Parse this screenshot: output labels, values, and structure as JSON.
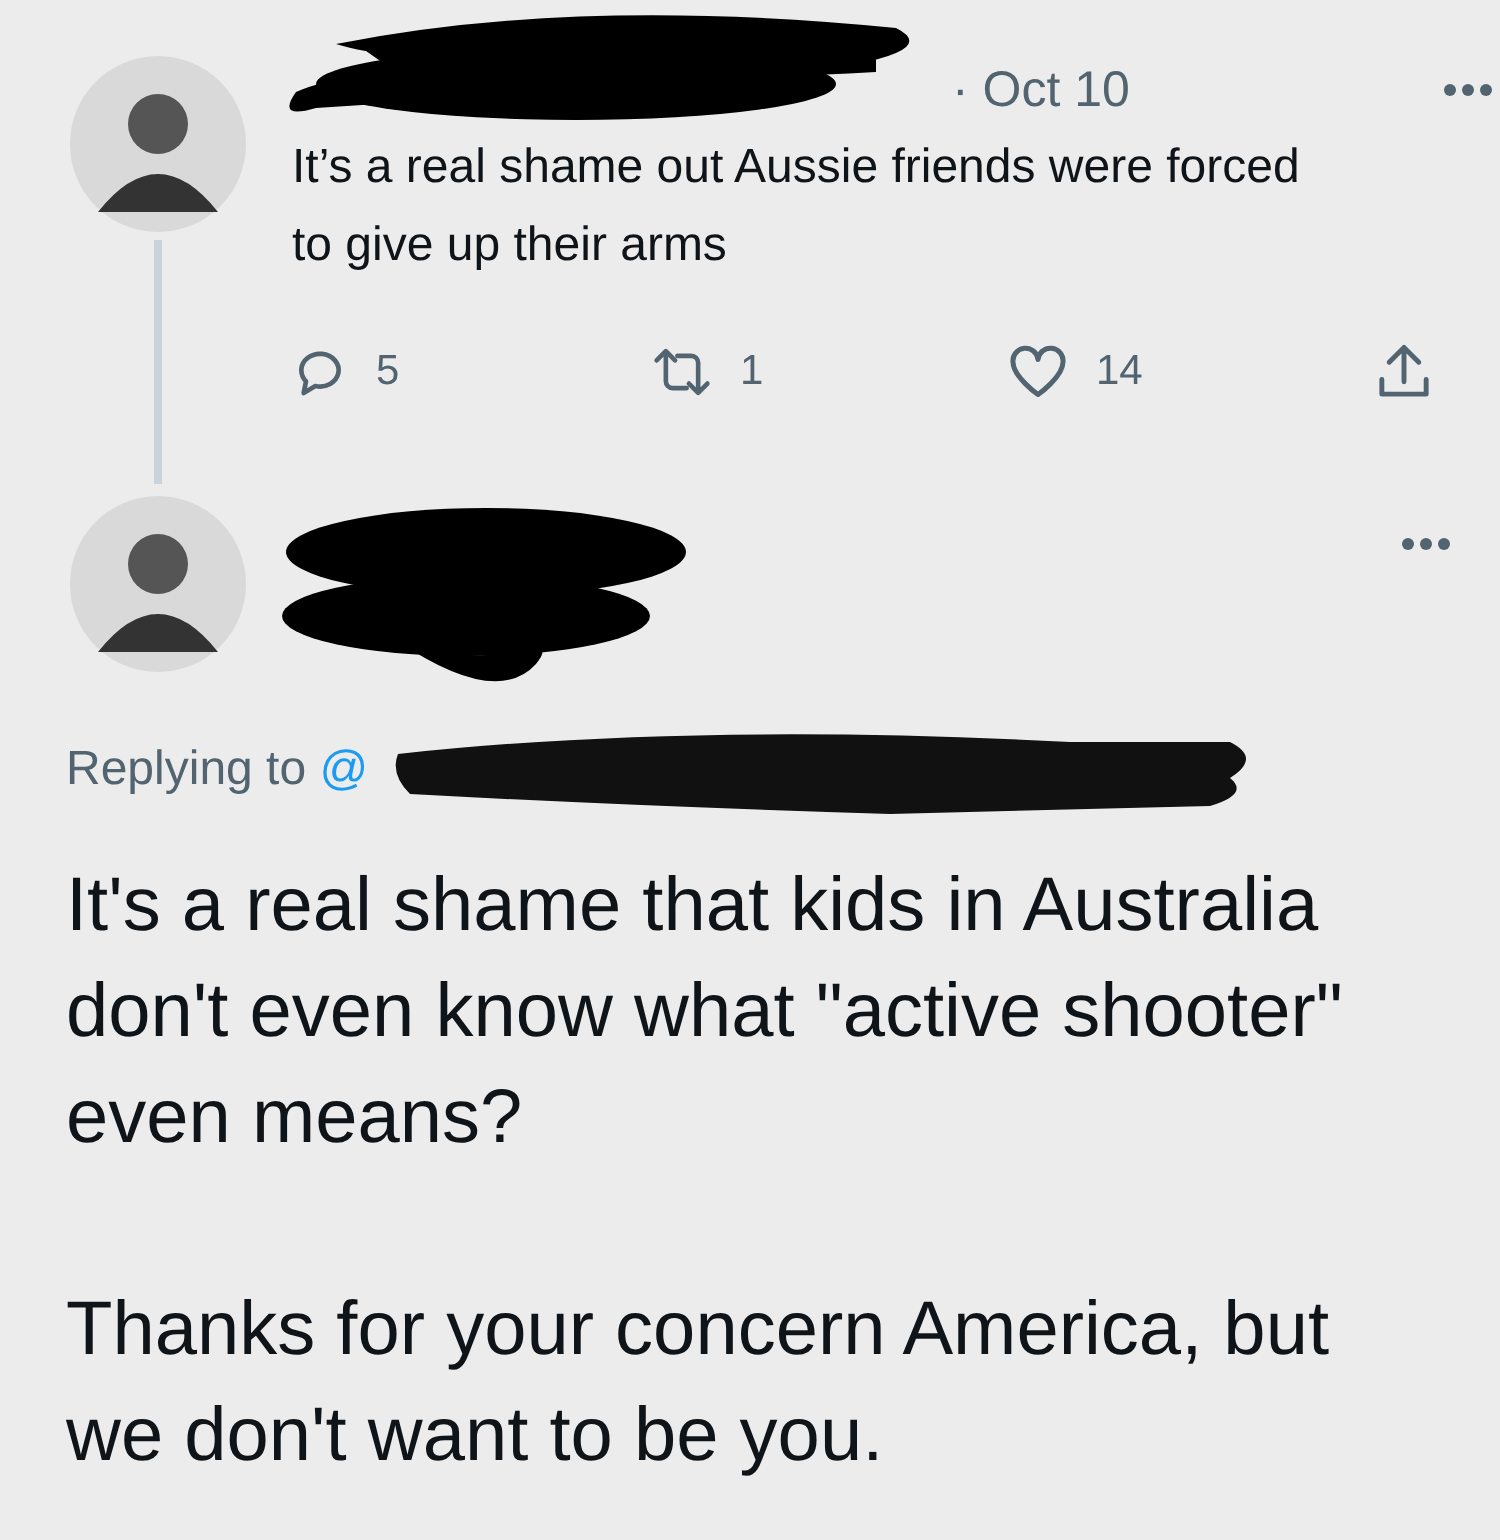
{
  "parent_tweet": {
    "date": "· Oct 10",
    "text": "It’s a real shame out Aussie friends were forced to give up their arms",
    "actions": [
      {
        "kind": "reply",
        "count": "5"
      },
      {
        "kind": "retweet",
        "count": "1"
      },
      {
        "kind": "like",
        "count": "14"
      },
      {
        "kind": "share"
      }
    ]
  },
  "reply_tweet": {
    "replying_to": "Replying to",
    "mention": "@",
    "paragraphs": [
      "It's a real shame that kids in Australia don't even know what \"active shooter\" even means?",
      "Thanks for your concern America, but we don't want to be you."
    ]
  }
}
